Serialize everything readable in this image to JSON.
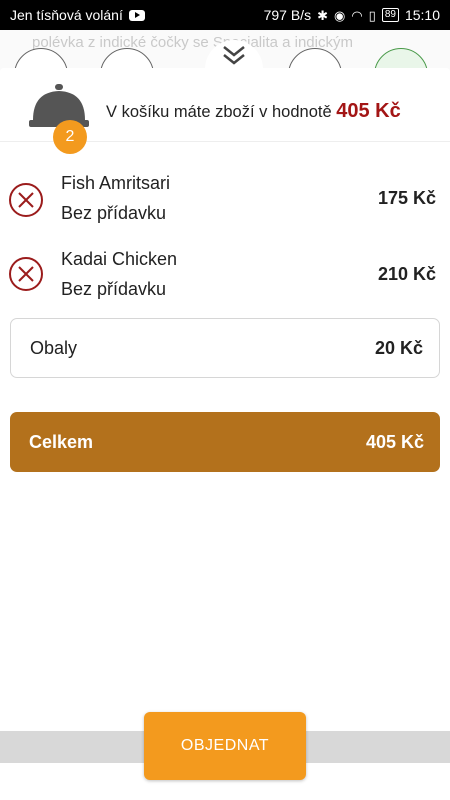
{
  "status_bar": {
    "carrier": "Jen tísňová volání",
    "speed": "797 B/s",
    "battery": "89",
    "time": "15:10"
  },
  "background": {
    "text": "polévka z indické čočky se Specialita a indickým",
    "categories": [
      "search-icon",
      "drink-icon",
      "dish-icon",
      "soup-icon",
      "plate-icon"
    ]
  },
  "cart": {
    "message": "V košíku máte zboží v hodnotě",
    "total": "405 Kč",
    "item_count": "2"
  },
  "items": [
    {
      "name": "Fish Amritsari",
      "addon": "Bez přídavku",
      "price": "175 Kč"
    },
    {
      "name": "Kadai Chicken",
      "addon": "Bez přídavku",
      "price": "210 Kč"
    }
  ],
  "packaging": {
    "label": "Obaly",
    "price": "20 Kč"
  },
  "total": {
    "label": "Celkem",
    "price": "405 Kč"
  },
  "order_button": "OBJEDNAT",
  "colors": {
    "accent_orange": "#f39a1e",
    "total_brown": "#b3711c",
    "price_red": "#a31515",
    "remove_red": "#9b1c1c"
  }
}
